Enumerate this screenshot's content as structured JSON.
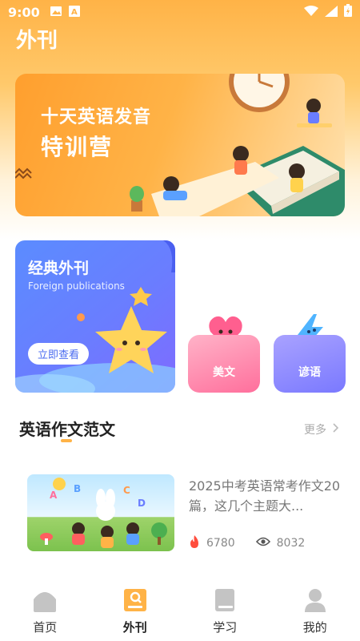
{
  "status_bar": {
    "time": "9:00"
  },
  "app": {
    "title": "外刊"
  },
  "banner": {
    "line1": "十天英语发音",
    "line2": "特训营"
  },
  "classic_card": {
    "title": "经典外刊",
    "subtitle": "Foreign publications",
    "button_label": "立即查看"
  },
  "mini_cards": [
    {
      "label": "美文"
    },
    {
      "label": "谚语"
    }
  ],
  "section": {
    "title": "英语作文范文",
    "more_label": "更多"
  },
  "article": {
    "title": "2025中考英语常考作文20篇，这几个主题大...",
    "hot_count": "6780",
    "view_count": "8032"
  },
  "tabbar": {
    "items": [
      {
        "label": "首页"
      },
      {
        "label": "外刊"
      },
      {
        "label": "学习"
      },
      {
        "label": "我的"
      }
    ],
    "active_index": 1
  },
  "colors": {
    "accent_orange": "#ffb347",
    "classic_blue": "#6a7dff",
    "pink": "#ff6f9c",
    "purple": "#7a79ff"
  }
}
